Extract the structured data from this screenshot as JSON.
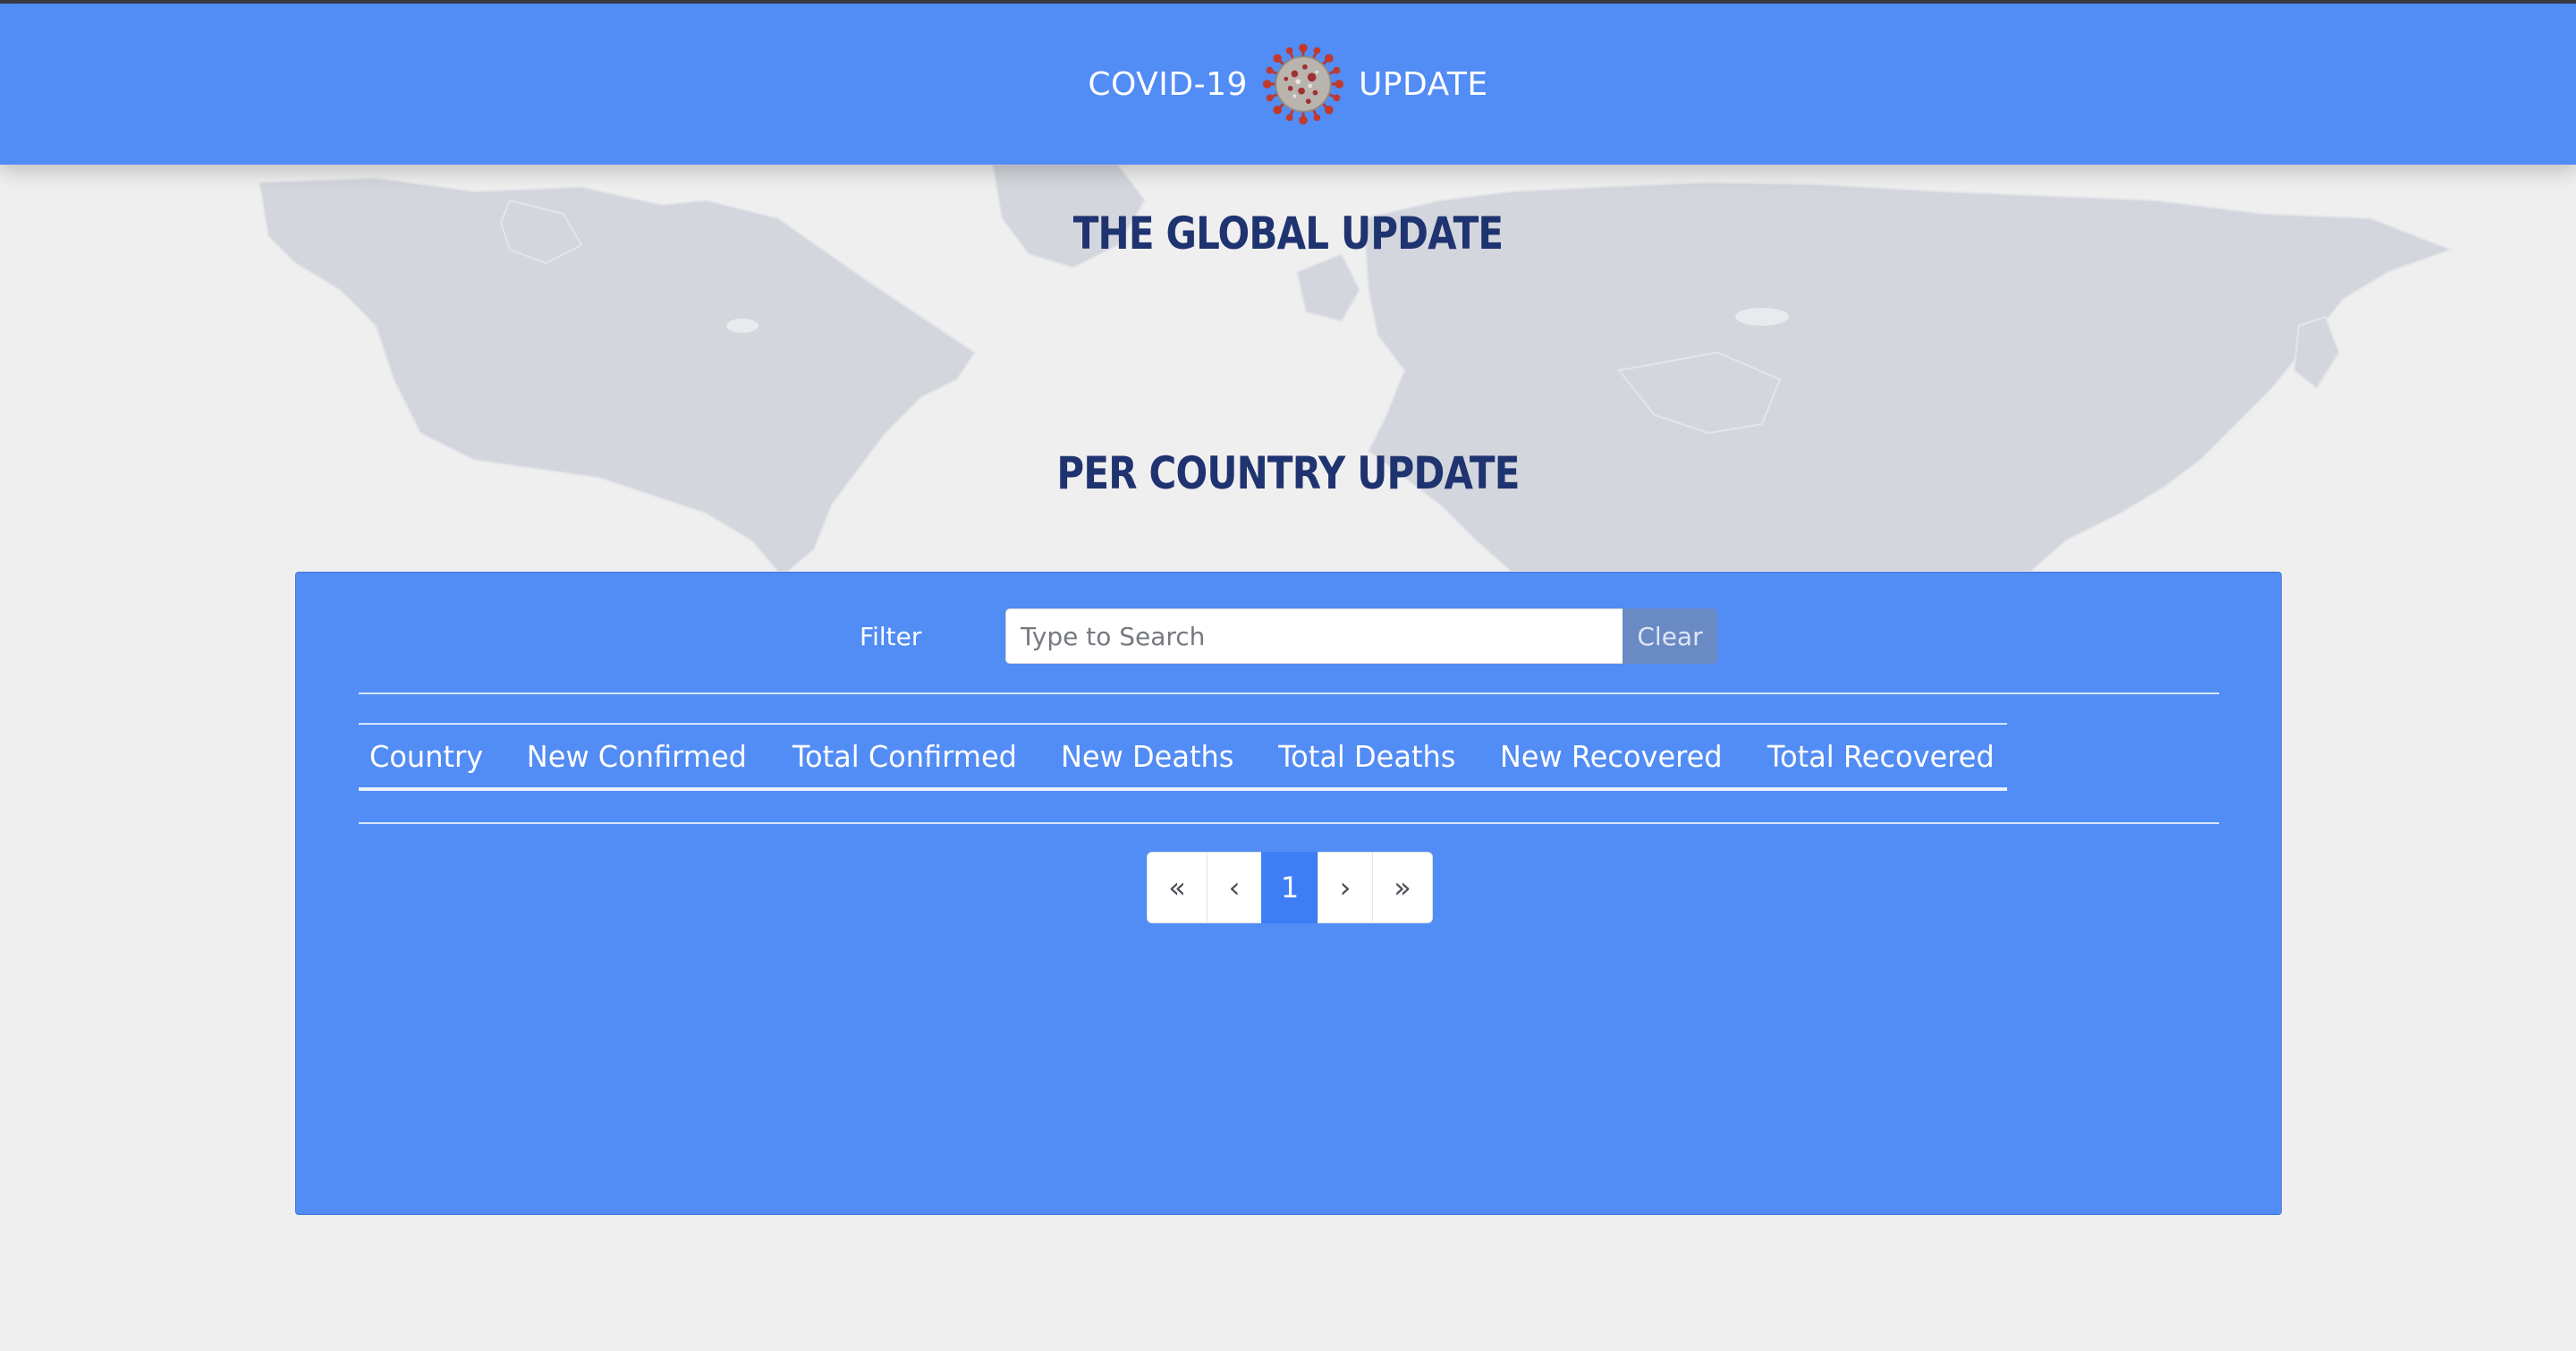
{
  "header": {
    "brand_left": "COVID-19",
    "brand_right": "UPDATE",
    "brand_icon": "virus-icon"
  },
  "sections": {
    "global_title": "THE GLOBAL UPDATE",
    "country_title": "PER COUNTRY UPDATE"
  },
  "filter": {
    "label": "Filter",
    "placeholder": "Type to Search",
    "value": "",
    "clear_label": "Clear"
  },
  "table": {
    "columns": [
      "Country",
      "New Confirmed",
      "Total Confirmed",
      "New Deaths",
      "Total Deaths",
      "New Recovered",
      "Total Recovered"
    ],
    "rows": []
  },
  "pagination": {
    "first": "«",
    "prev": "‹",
    "current": "1",
    "next": "›",
    "last": "»"
  },
  "colors": {
    "header_bg": "#528cf5",
    "panel_bg": "#528cf5",
    "heading_text": "#1f3370",
    "page_bg": "#efefef",
    "active_page": "#3d7ef4",
    "clear_button": "#6a8ac4",
    "map_land": "#d3d6dc"
  }
}
